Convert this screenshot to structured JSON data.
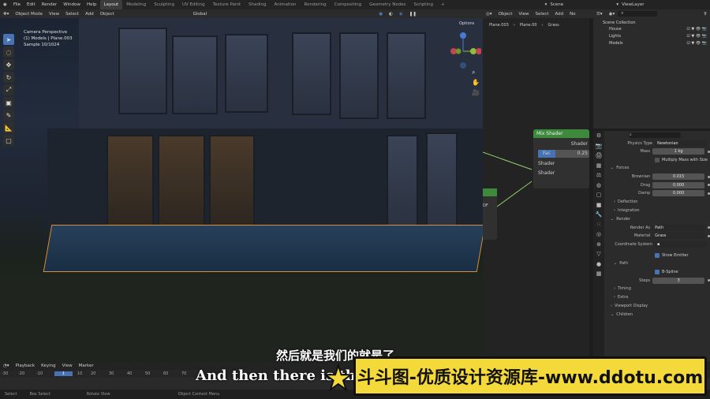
{
  "topbar": {
    "menus": [
      "File",
      "Edit",
      "Render",
      "Window",
      "Help"
    ],
    "workspaces": [
      "Layout",
      "Modeling",
      "Sculpting",
      "UV Editing",
      "Texture Paint",
      "Shading",
      "Animation",
      "Rendering",
      "Compositing",
      "Geometry Nodes",
      "Scripting"
    ],
    "active_workspace": "Layout",
    "scene": "Scene",
    "view_layer": "ViewLayer"
  },
  "viewport_header": {
    "mode": "Object Mode",
    "menus": [
      "View",
      "Select",
      "Add",
      "Object"
    ],
    "orientation": "Global",
    "options": "Options"
  },
  "viewport_overlay": {
    "line1": "Camera Perspective",
    "line2": "(1) Models | Plane.003",
    "line3": "Sample 10/1024"
  },
  "node_header": {
    "mode": "Object",
    "menus": [
      "View",
      "Select",
      "Add",
      "No"
    ]
  },
  "breadcrumb": [
    "Plane.003",
    "Plane.00",
    "Grass"
  ],
  "mix_shader": {
    "title": "Mix Shader",
    "output": "Shader",
    "fac_label": "Fac",
    "fac_value": "0.25",
    "inputs": [
      "Shader",
      "Shader"
    ]
  },
  "partial_node": {
    "label": "DF"
  },
  "outliner": {
    "root": "Scene Collection",
    "items": [
      "House",
      "Lights",
      "Models"
    ]
  },
  "properties": {
    "physics_type_label": "Physics Type",
    "physics_type": "Newtonian",
    "mass_label": "Mass",
    "mass": "1 kg",
    "multiply_mass": "Multiply Mass with Size",
    "forces": "Forces",
    "brownian_label": "Brownian",
    "brownian": "0.015",
    "drag_label": "Drag",
    "drag": "0.000",
    "damp_label": "Damp",
    "damp": "0.000",
    "deflection": "Deflection",
    "integration": "Integration",
    "render": "Render",
    "render_as_label": "Render As",
    "render_as": "Path",
    "material_label": "Material",
    "material": "Grass",
    "coord_label": "Coordinate System",
    "show_emitter": "Show Emitter",
    "path": "Path",
    "bspline": "B-Spline",
    "steps_label": "Steps",
    "steps": "3",
    "timing": "Timing",
    "extra": "Extra",
    "viewport_display": "Viewport Display",
    "children": "Children"
  },
  "timeline": {
    "menus": [
      "Playback",
      "Keying",
      "View",
      "Marker"
    ],
    "frames": [
      "-30",
      "-20",
      "-10",
      "1",
      "10",
      "20",
      "30",
      "40",
      "50",
      "60",
      "70"
    ],
    "current_frame": "1",
    "status": [
      "Select",
      "Box Select",
      "Rotate View",
      "Object Context Menu"
    ]
  },
  "subtitles": {
    "cn": "然后就是我们的就是了",
    "en": "And then there is the"
  },
  "watermark": "斗斗图-优质设计资源库-www.ddotu.com"
}
